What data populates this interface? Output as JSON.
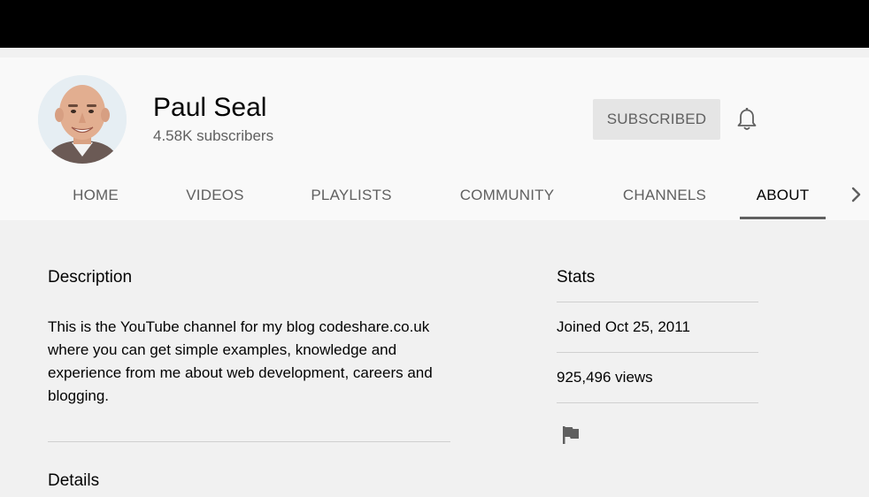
{
  "channel": {
    "name": "Paul Seal",
    "subscribers": "4.58K subscribers",
    "subscribe_label": "SUBSCRIBED"
  },
  "tabs": [
    {
      "label": "HOME",
      "active": false
    },
    {
      "label": "VIDEOS",
      "active": false
    },
    {
      "label": "PLAYLISTS",
      "active": false
    },
    {
      "label": "COMMUNITY",
      "active": false
    },
    {
      "label": "CHANNELS",
      "active": false
    },
    {
      "label": "ABOUT",
      "active": true
    }
  ],
  "about": {
    "description_title": "Description",
    "description_text": "This is the YouTube channel for my blog codeshare.co.uk\nwhere you can get simple examples, knowledge and\nexperience from me about web development, careers and\nblogging.",
    "details_title": "Details"
  },
  "stats": {
    "title": "Stats",
    "joined": "Joined Oct 25, 2011",
    "views": "925,496 views"
  },
  "icons": {
    "bell": "bell-icon",
    "next": "chevron-right-icon",
    "report": "flag-icon"
  },
  "colors": {
    "header_bg": "#f9f9f9",
    "page_bg": "#f1f1f1",
    "subscribed_bg": "#e5e5e5",
    "text_secondary": "#606060"
  }
}
